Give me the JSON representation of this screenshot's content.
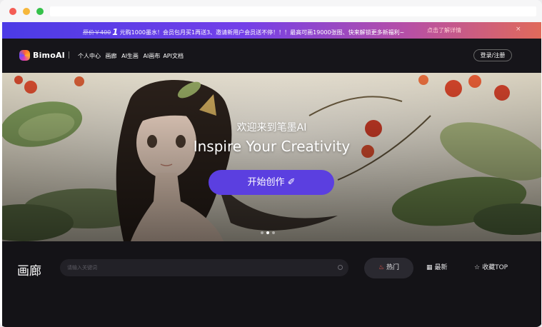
{
  "promo": {
    "old_price": "原价￥400",
    "price_big": "1",
    "text": "元购1000墨水！会员包月买1再送3、邀请新用户会员送不停！！！最高可画19000张图、快来解锁更多新福利~",
    "link": "点击了解详情",
    "close": "×"
  },
  "nav": {
    "logo_text": "BimoAI",
    "links": [
      "个人中心",
      "画廊",
      "AI生画",
      "AI画布",
      "API文档"
    ],
    "login": "登录/注册"
  },
  "hero": {
    "title": "欢迎来到笔墨AI",
    "subtitle": "Inspire Your Creativity",
    "button": "开始创作 ✐",
    "carousel_count": 3,
    "carousel_active": 1
  },
  "gallery": {
    "title": "画廊",
    "search_placeholder": "请输入关键词",
    "tabs": [
      {
        "label": "热门",
        "icon": "fire-icon",
        "active": true
      },
      {
        "label": "最新",
        "icon": "calendar-icon",
        "active": false
      },
      {
        "label": "收藏TOP",
        "icon": "star-icon",
        "active": false
      }
    ]
  },
  "colors": {
    "accent": "#5b3fe0",
    "promo_gradient_start": "#4b3be6",
    "promo_gradient_end": "#e06a5b",
    "nav_bg": "#16151a"
  }
}
